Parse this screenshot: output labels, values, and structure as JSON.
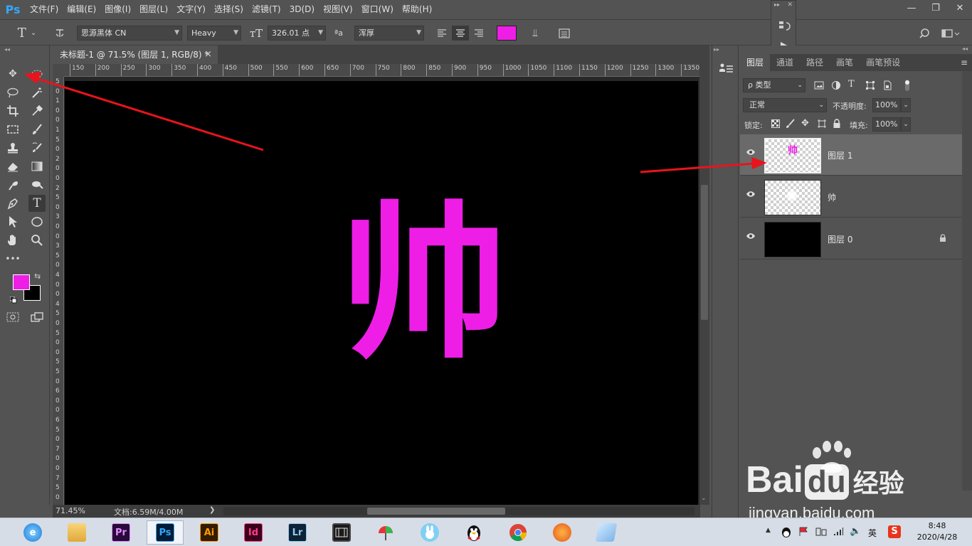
{
  "app": {
    "logo": "Ps",
    "menu": [
      "文件(F)",
      "编辑(E)",
      "图像(I)",
      "图层(L)",
      "文字(Y)",
      "选择(S)",
      "滤镜(T)",
      "3D(D)",
      "视图(V)",
      "窗口(W)",
      "帮助(H)"
    ],
    "window_controls": {
      "minimize": "—",
      "restore": "❐",
      "close": "✕"
    }
  },
  "options": {
    "tool_icon": "T",
    "font_family": "思源黑体 CN",
    "font_style": "Heavy",
    "font_size": "326.01 点",
    "aa_label": "ªa",
    "antialias": "浑厚",
    "text_color": "#ee1ee6"
  },
  "document": {
    "tab_title": "未标题-1 @ 71.5% (图层 1, RGB/8) *",
    "tab_close": "×",
    "ruler_ticks": [
      "150",
      "200",
      "250",
      "300",
      "350",
      "400",
      "450",
      "500",
      "550",
      "600",
      "650",
      "700",
      "750",
      "800",
      "850",
      "900",
      "950",
      "1000",
      "1050",
      "1100",
      "1150",
      "1200",
      "1250",
      "1300",
      "1350"
    ],
    "ruler_left_ticks": [
      "5",
      "0",
      "1",
      "0",
      "0",
      "1",
      "5",
      "0",
      "2",
      "0",
      "0",
      "2",
      "5",
      "0",
      "3",
      "0",
      "0",
      "3",
      "5",
      "0",
      "4",
      "0",
      "0",
      "4",
      "5",
      "0",
      "5",
      "0",
      "0",
      "5",
      "5",
      "0",
      "6",
      "0",
      "0",
      "6",
      "5",
      "0",
      "7",
      "0",
      "0",
      "7",
      "5",
      "0"
    ],
    "canvas_text": "帅",
    "canvas_text_color": "#ee1ee6",
    "zoom": "71.45%",
    "doc_size": "文档:6.59M/4.00M",
    "status_arrow": "❯"
  },
  "swatches": {
    "foreground": "#ee1ee6",
    "background": "#000000"
  },
  "layers_panel": {
    "tabs": [
      "图层",
      "通道",
      "路径",
      "画笔",
      "画笔预设"
    ],
    "filter_label": "ρ 类型",
    "blend_mode": "正常",
    "opacity_label": "不透明度:",
    "opacity_value": "100%",
    "lock_label": "锁定:",
    "fill_label": "填充:",
    "fill_value": "100%",
    "layers": [
      {
        "name": "图层 1",
        "selected": true,
        "thumb_text": "帅"
      },
      {
        "name": "帅",
        "selected": false,
        "thumb_text": ""
      },
      {
        "name": "图层 0",
        "selected": false,
        "thumb_text": "",
        "locked": true
      }
    ]
  },
  "taskbar": {
    "apps": [
      {
        "name": "ie",
        "label": "e"
      },
      {
        "name": "explorer",
        "label": ""
      },
      {
        "name": "premiere",
        "label": "Pr"
      },
      {
        "name": "photoshop",
        "label": "Ps"
      },
      {
        "name": "illustrator",
        "label": "Ai"
      },
      {
        "name": "indesign",
        "label": "Id"
      },
      {
        "name": "lightroom",
        "label": "Lr"
      },
      {
        "name": "film",
        "label": ""
      },
      {
        "name": "beach",
        "label": ""
      },
      {
        "name": "rabbit",
        "label": ""
      },
      {
        "name": "qq",
        "label": ""
      },
      {
        "name": "chrome",
        "label": ""
      },
      {
        "name": "fox",
        "label": ""
      },
      {
        "name": "notes",
        "label": ""
      }
    ],
    "ime": "英",
    "clock_time": "8:48",
    "clock_date": "2020/4/28"
  },
  "watermark": {
    "brand": "Bai",
    "du": "du",
    "suffix": "经验",
    "url": "jingyan.baidu.com"
  }
}
